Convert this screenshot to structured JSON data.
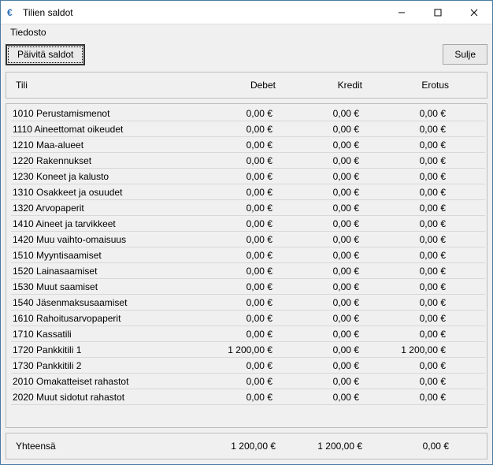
{
  "window": {
    "title": "Tilien saldot"
  },
  "menu": {
    "file": "Tiedosto"
  },
  "toolbar": {
    "refresh": "Päivitä saldot",
    "close": "Sulje"
  },
  "columns": {
    "account": "Tili",
    "debit": "Debet",
    "credit": "Kredit",
    "diff": "Erotus"
  },
  "rows": [
    {
      "name": "1010 Perustamismenot",
      "debit": "0,00 €",
      "credit": "0,00 €",
      "diff": "0,00 €"
    },
    {
      "name": "1110 Aineettomat oikeudet",
      "debit": "0,00 €",
      "credit": "0,00 €",
      "diff": "0,00 €"
    },
    {
      "name": "1210 Maa-alueet",
      "debit": "0,00 €",
      "credit": "0,00 €",
      "diff": "0,00 €"
    },
    {
      "name": "1220 Rakennukset",
      "debit": "0,00 €",
      "credit": "0,00 €",
      "diff": "0,00 €"
    },
    {
      "name": "1230 Koneet ja kalusto",
      "debit": "0,00 €",
      "credit": "0,00 €",
      "diff": "0,00 €"
    },
    {
      "name": "1310 Osakkeet ja osuudet",
      "debit": "0,00 €",
      "credit": "0,00 €",
      "diff": "0,00 €"
    },
    {
      "name": "1320 Arvopaperit",
      "debit": "0,00 €",
      "credit": "0,00 €",
      "diff": "0,00 €"
    },
    {
      "name": "1410 Aineet ja tarvikkeet",
      "debit": "0,00 €",
      "credit": "0,00 €",
      "diff": "0,00 €"
    },
    {
      "name": "1420 Muu vaihto-omaisuus",
      "debit": "0,00 €",
      "credit": "0,00 €",
      "diff": "0,00 €"
    },
    {
      "name": "1510 Myyntisaamiset",
      "debit": "0,00 €",
      "credit": "0,00 €",
      "diff": "0,00 €"
    },
    {
      "name": "1520 Lainasaamiset",
      "debit": "0,00 €",
      "credit": "0,00 €",
      "diff": "0,00 €"
    },
    {
      "name": "1530 Muut saamiset",
      "debit": "0,00 €",
      "credit": "0,00 €",
      "diff": "0,00 €"
    },
    {
      "name": "1540 Jäsenmaksusaamiset",
      "debit": "0,00 €",
      "credit": "0,00 €",
      "diff": "0,00 €"
    },
    {
      "name": "1610 Rahoitusarvopaperit",
      "debit": "0,00 €",
      "credit": "0,00 €",
      "diff": "0,00 €"
    },
    {
      "name": "1710 Kassatili",
      "debit": "0,00 €",
      "credit": "0,00 €",
      "diff": "0,00 €"
    },
    {
      "name": "1720 Pankkitili 1",
      "debit": "1 200,00 €",
      "credit": "0,00 €",
      "diff": "1 200,00 €"
    },
    {
      "name": "1730 Pankkitili 2",
      "debit": "0,00 €",
      "credit": "0,00 €",
      "diff": "0,00 €"
    },
    {
      "name": "2010 Omakatteiset rahastot",
      "debit": "0,00 €",
      "credit": "0,00 €",
      "diff": "0,00 €"
    },
    {
      "name": "2020 Muut sidotut rahastot",
      "debit": "0,00 €",
      "credit": "0,00 €",
      "diff": "0,00 €"
    }
  ],
  "total": {
    "label": "Yhteensä",
    "debit": "1 200,00 €",
    "credit": "1 200,00 €",
    "diff": "0,00 €"
  }
}
